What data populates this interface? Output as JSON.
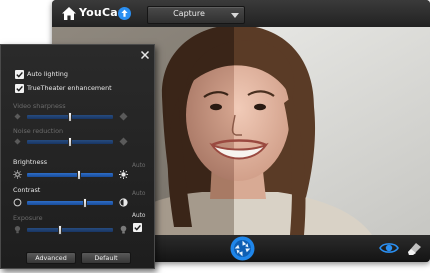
{
  "app": {
    "name": "YouCam",
    "mode": "Capture"
  },
  "settings": {
    "auto_lighting": {
      "label": "Auto lighting",
      "checked": true
    },
    "truetheater": {
      "label": "TrueTheater enhancement",
      "checked": true
    },
    "video_sharpness": {
      "label": "Video sharpness",
      "value": 0.5
    },
    "noise_reduction": {
      "label": "Noise reduction",
      "value": 0.5
    },
    "brightness": {
      "label": "Brightness",
      "value": 0.6,
      "auto_label": "Auto"
    },
    "contrast": {
      "label": "Contrast",
      "value": 0.67,
      "auto_label": "Auto"
    },
    "exposure": {
      "label": "Exposure",
      "value": 0.38,
      "auto_label": "Auto",
      "auto_checked": true
    },
    "buttons": {
      "advanced": "Advanced",
      "default": "Default"
    }
  },
  "colors": {
    "slider_blue": "#2f6ec7",
    "accent_blue": "#2a8ff2"
  }
}
